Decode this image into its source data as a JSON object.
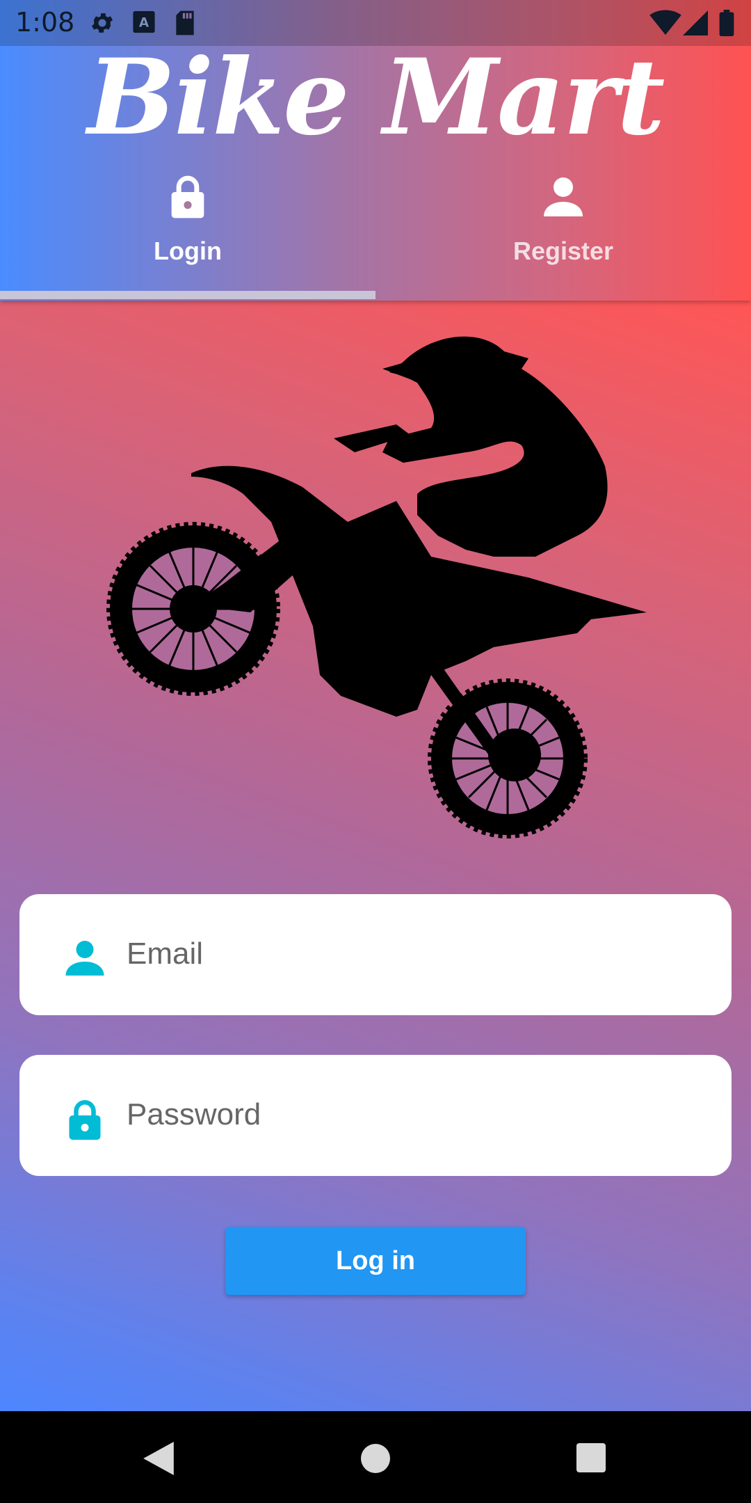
{
  "status_bar": {
    "time": "1:08",
    "icons": [
      "gear-icon",
      "keyboard-a-icon",
      "sd-card-icon",
      "wifi-icon",
      "signal-icon",
      "battery-icon"
    ]
  },
  "header": {
    "title": "Bike Mart",
    "tabs": [
      {
        "label": "Login",
        "icon": "lock-icon",
        "selected": true
      },
      {
        "label": "Register",
        "icon": "person-icon",
        "selected": false
      }
    ]
  },
  "form": {
    "email_placeholder": "Email",
    "password_placeholder": "Password",
    "login_label": "Log in"
  },
  "illustration": {
    "icon": "motocross-rider-silhouette"
  },
  "nav": {
    "icons": [
      "back-icon",
      "home-icon",
      "recents-icon"
    ]
  },
  "colors": {
    "accent": "#2196f3",
    "field_icon": "#00bcd4",
    "gradient_left": "#4a8cff",
    "gradient_right": "#ff5252"
  }
}
